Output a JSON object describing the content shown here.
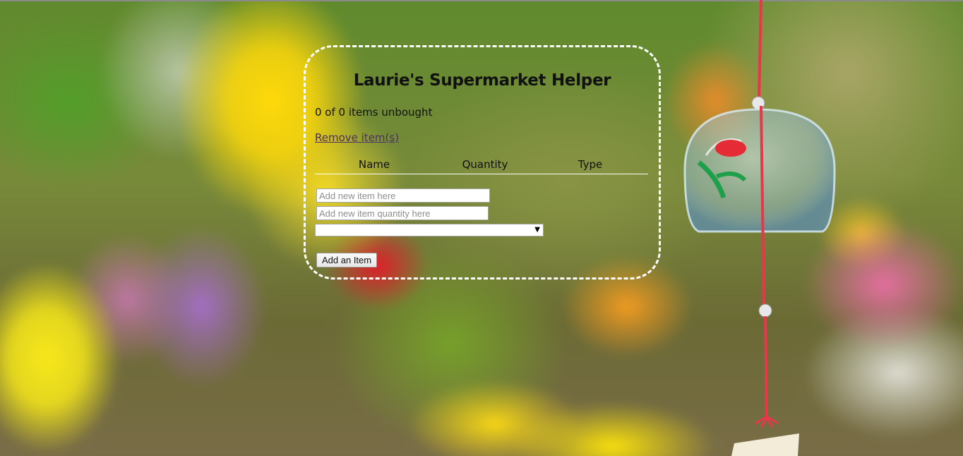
{
  "app": {
    "title": "Laurie's Supermarket Helper",
    "status_text": "0 of 0 items unbought",
    "remove_link": "Remove item(s)"
  },
  "table": {
    "headers": [
      "Name",
      "Quantity",
      "Type"
    ],
    "rows": []
  },
  "form": {
    "name_placeholder": "Add new item here",
    "name_value": "",
    "quantity_placeholder": "Add new item quantity here",
    "quantity_value": "",
    "type_selected": "",
    "add_button": "Add an Item"
  },
  "colors": {
    "card_border": "#ffffff",
    "link": "#4a2f66",
    "text": "#111111"
  },
  "icons": {
    "select_arrow": "chevron-down-icon"
  }
}
